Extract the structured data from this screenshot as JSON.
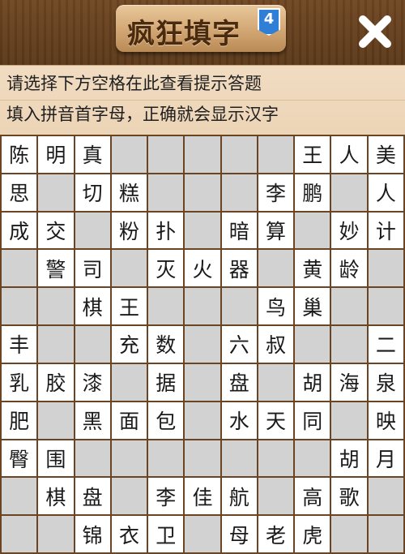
{
  "header": {
    "title": "疯狂填字",
    "level_badge": "4",
    "close_icon": "close-icon"
  },
  "hints": {
    "line1": "请选择下方空格在此查看提示答题",
    "line2": "填入拼音首字母，正确就会显示汉字"
  },
  "colors": {
    "header_bg": "#6a4320",
    "plaque": "#d8ad7b",
    "title_text": "#4b2b10",
    "badge_blue": "#2f7fd6",
    "hint_bg": "#efd9be",
    "cell_empty": "#d2d2d2",
    "cell_filled": "#ffffff",
    "grid_line": "#6b4423"
  },
  "grid": {
    "rows": [
      [
        "陈",
        "明",
        "真",
        "#",
        "#",
        "#",
        "#",
        "#",
        "王",
        "人",
        "美"
      ],
      [
        "思",
        "#",
        "切",
        "糕",
        "#",
        "#",
        "#",
        "李",
        "鹏",
        "#",
        "人"
      ],
      [
        "成",
        "交",
        "#",
        "粉",
        "扑",
        "#",
        "暗",
        "算",
        "#",
        "妙",
        "计"
      ],
      [
        "#",
        "警",
        "司",
        "#",
        "灭",
        "火",
        "器",
        "#",
        "黄",
        "龄",
        "#"
      ],
      [
        "#",
        "#",
        "棋",
        "王",
        "#",
        "#",
        "#",
        "鸟",
        "巢",
        "#",
        "#"
      ],
      [
        "丰",
        "#",
        "#",
        "充",
        "数",
        "#",
        "六",
        "叔",
        "#",
        "#",
        "二"
      ],
      [
        "乳",
        "胶",
        "漆",
        "#",
        "据",
        "#",
        "盘",
        "#",
        "胡",
        "海",
        "泉"
      ],
      [
        "肥",
        "#",
        "黑",
        "面",
        "包",
        "#",
        "水",
        "天",
        "同",
        "#",
        "映"
      ],
      [
        "臀",
        "围",
        "#",
        "#",
        "#",
        "#",
        "#",
        "#",
        "#",
        "胡",
        "月"
      ],
      [
        "#",
        "棋",
        "盘",
        "#",
        "李",
        "佳",
        "航",
        "#",
        "高",
        "歌",
        "#"
      ],
      [
        "#",
        "#",
        "锦",
        "衣",
        "卫",
        "#",
        "母",
        "老",
        "虎",
        "#",
        "#"
      ]
    ]
  }
}
